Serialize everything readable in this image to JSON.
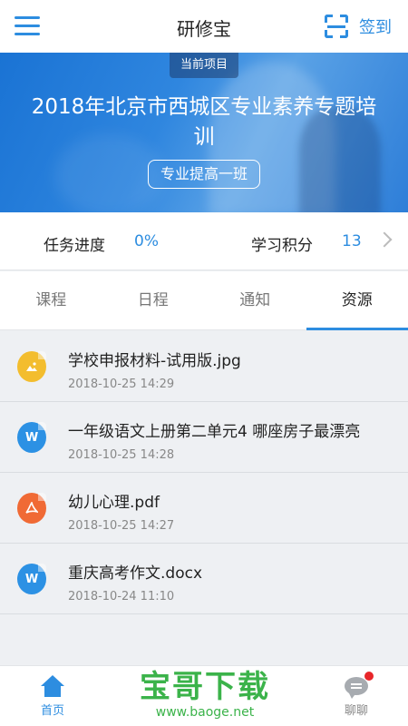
{
  "header": {
    "title": "研修宝",
    "checkin_label": "签到"
  },
  "banner": {
    "current_tag": "当前项目",
    "project_title": "2018年北京市西城区专业素养专题培训",
    "class_name": "专业提高一班"
  },
  "stats": {
    "progress_label": "任务进度",
    "progress_value": "0%",
    "points_label": "学习积分",
    "points_value": "13"
  },
  "tabs": [
    {
      "label": "课程"
    },
    {
      "label": "日程"
    },
    {
      "label": "通知"
    },
    {
      "label": "资源",
      "active": true
    }
  ],
  "files": [
    {
      "icon": "image-file-icon",
      "name": "学校申报材料-试用版.jpg",
      "time": "2018-10-25 14:29"
    },
    {
      "icon": "word-file-icon",
      "name": "一年级语文上册第二单元4 哪座房子最漂亮",
      "time": "2018-10-25 14:28",
      "icon_letter": "W"
    },
    {
      "icon": "pdf-file-icon",
      "name": "幼儿心理.pdf",
      "time": "2018-10-25 14:27"
    },
    {
      "icon": "word-file-icon",
      "name": "重庆高考作文.docx",
      "time": "2018-10-24 11:10",
      "icon_letter": "W"
    }
  ],
  "bottom_nav": {
    "home_label": "首页",
    "chat_label": "聊聊"
  },
  "watermark": {
    "text": "宝哥下载",
    "url": "www.baoge.net"
  },
  "colors": {
    "accent": "#2d8de0",
    "image_icon": "#f3bd2e",
    "word_icon": "#2c91e4",
    "pdf_icon": "#f06a35",
    "watermark": "#3bb34a"
  }
}
